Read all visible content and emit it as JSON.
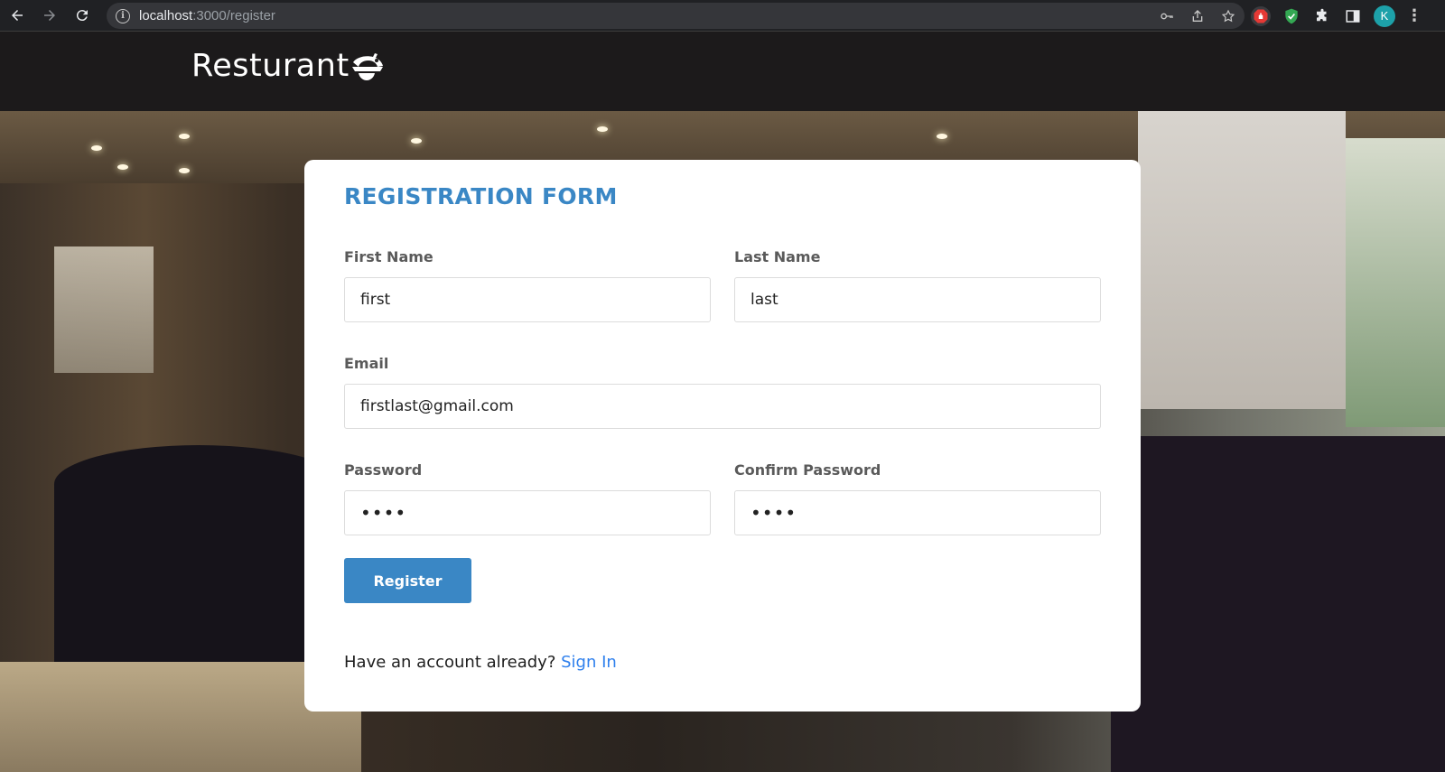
{
  "browser": {
    "url_host": "localhost",
    "url_path": ":3000/register",
    "profile_initial": "K"
  },
  "site": {
    "logo_text": "Resturant"
  },
  "form": {
    "title": "REGISTRATION FORM",
    "first_name": {
      "label": "First Name",
      "value": "first"
    },
    "last_name": {
      "label": "Last Name",
      "value": "last"
    },
    "email": {
      "label": "Email",
      "value": "firstlast@gmail.com"
    },
    "password": {
      "label": "Password",
      "value": "••••"
    },
    "confirm_password": {
      "label": "Confirm Password",
      "value": "••••"
    },
    "register_label": "Register",
    "signin_prompt": "Have an account already?",
    "signin_link": "Sign In"
  },
  "colors": {
    "accent": "#3a87c5",
    "link": "#2f80ed",
    "header_bg": "#1c1a1b"
  }
}
